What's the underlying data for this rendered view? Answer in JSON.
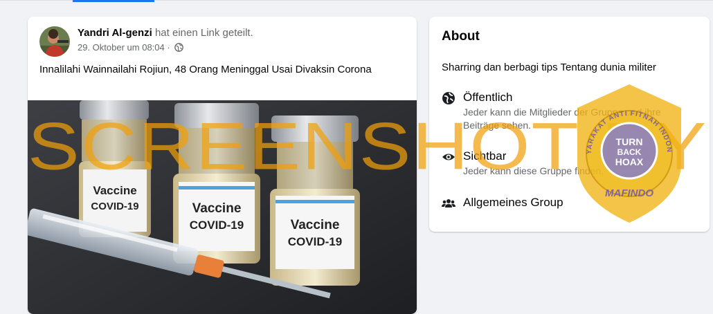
{
  "post": {
    "author": "Yandri Al-genzi",
    "action": "hat einen Link geteilt.",
    "timestamp": "29. Oktober um 08:04",
    "separator": "·",
    "text": "Innalilahi Wainnailahi Rojiun, 48 Orang Meninggal Usai Divaksin Corona",
    "image_labels": {
      "vial1_line1": "Vaccine",
      "vial1_line2": "COVID-19",
      "vial2_line1": "Vaccine",
      "vial2_line2": "COVID-19",
      "vial3_line1": "Vaccine",
      "vial3_line2": "COVID-19"
    }
  },
  "about": {
    "title": "About",
    "description": "Sharring dan berbagi tips Tentang dunia militer",
    "privacy_title": "Öffentlich",
    "privacy_desc": "Jeder kann die Mitglieder der Gruppe und ihre Beiträge sehen.",
    "visibility_title": "Sichtbar",
    "visibility_desc": "Jeder kann diese Gruppe finden.",
    "type_title": "Allgemeines Group"
  },
  "watermark": {
    "text": "SCREENSHOT BY",
    "seal_center": "TURN BACK HOAX",
    "seal_ring": "MASYARAKAT ANTI FITNAH INDONESIA",
    "seal_bottom": "MAFINDO"
  },
  "colors": {
    "accent": "#1877f2",
    "watermark": "#f0a00a",
    "seal_inner": "#8a7fc4"
  }
}
